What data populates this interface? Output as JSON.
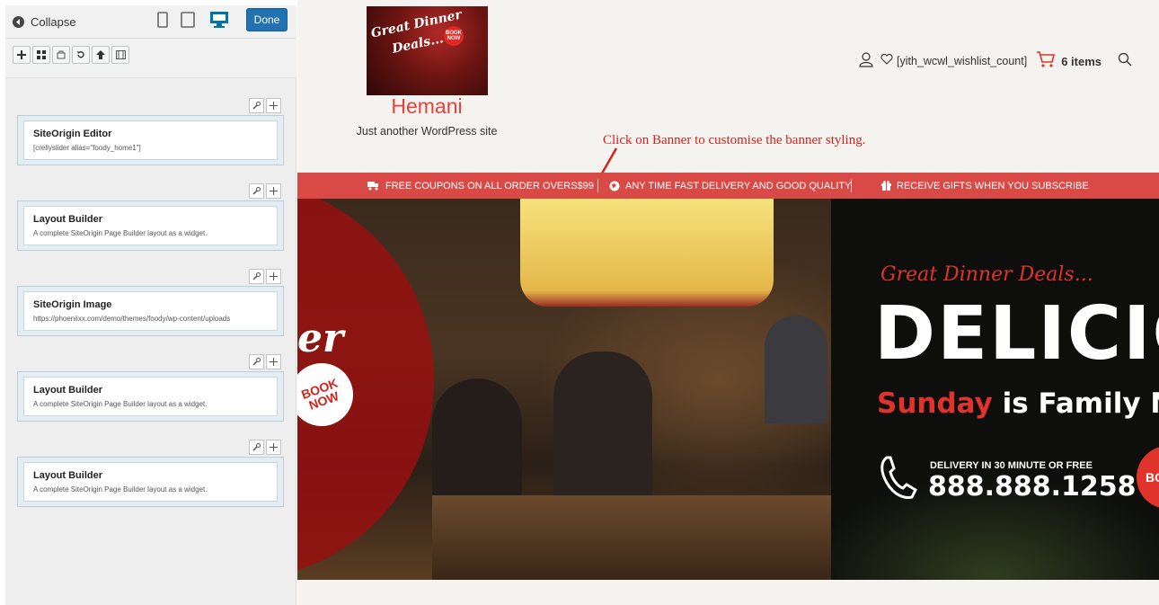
{
  "panel": {
    "collapse_label": "Collapse",
    "done_label": "Done",
    "devices": [
      "tablet-portrait",
      "tablet-landscape",
      "desktop"
    ],
    "toolbar_icons": [
      "add-widget-icon",
      "add-row-icon",
      "prebuilt-layout-icon",
      "history-icon",
      "move-up-icon",
      "live-editor-icon"
    ],
    "rows": [
      {
        "title": "SiteOrigin Editor",
        "desc": "[crellyslider alias=\"foody_home1\"]"
      },
      {
        "title": "Layout Builder",
        "desc": "A complete SiteOrigin Page Builder layout as a widget."
      },
      {
        "title": "SiteOrigin Image",
        "desc": "https://phoeniixx.com/demo/themes/foody/wp-content/uploads"
      },
      {
        "title": "Layout Builder",
        "desc": "A complete SiteOrigin Page Builder layout as a widget."
      },
      {
        "title": "Layout Builder",
        "desc": "A complete SiteOrigin Page Builder layout as a widget."
      }
    ]
  },
  "site": {
    "logo_line1": "Great Dinner",
    "logo_line2": "Deals...",
    "logo_badge": "BOOK NOW",
    "title": "Hemani",
    "tagline": "Just another WordPress site",
    "wishlist_label": "[yith_wcwl_wishlist_count]",
    "cart_label": "6 items",
    "annotation": "Click on Banner to customise the banner styling."
  },
  "topbar": {
    "items": [
      "FREE COUPONS ON ALL ORDER OVERS$99",
      "ANY TIME FAST DELIVERY AND GOOD QUALITY",
      "RECEIVE GIFTS WHEN YOU SUBSCRIBE"
    ]
  },
  "banner": {
    "left_script": "er",
    "left_book_1": "BOOK",
    "left_book_2": "NOW",
    "great": "Great Dinner Deals...",
    "headline": "DELICIO",
    "sunday": "Sunday",
    "family": " is Family N",
    "delivery": "DELIVERY IN 30 MINUTE OR FREE",
    "phone": "888.888.1258",
    "right_book": "BO"
  },
  "colors": {
    "accent_blue": "#2271b1",
    "site_red": "#d94a46",
    "title_red": "#e8403a",
    "annotation_red": "#d4221c"
  }
}
